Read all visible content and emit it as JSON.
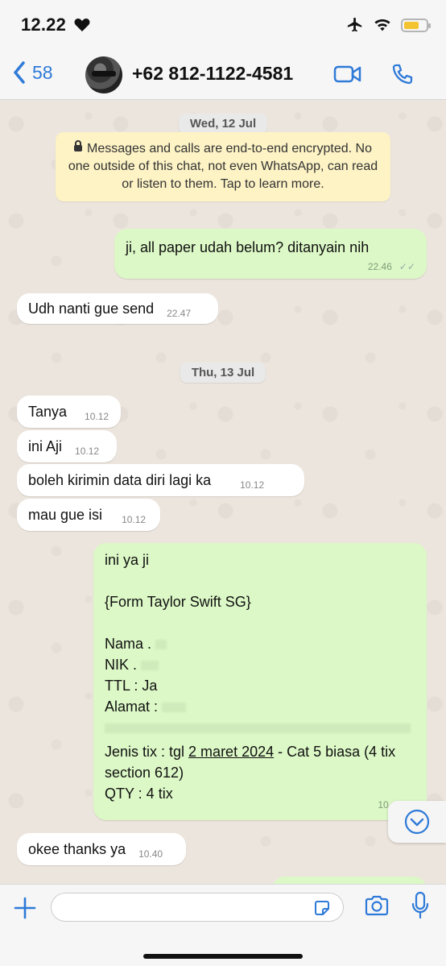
{
  "status_bar": {
    "time": "12.22"
  },
  "header": {
    "back_count": "58",
    "contact": "+62 812-1122-4581"
  },
  "chat": {
    "date1": "Wed, 12 Jul",
    "encryption_notice": "Messages and calls are end-to-end encrypted. No one outside of this chat, not even WhatsApp, can read or listen to them. Tap to learn more.",
    "msg1": {
      "text": "ji, all paper udah belum? ditanyain nih",
      "time": "22.46"
    },
    "msg2": {
      "text": "Udh nanti gue send",
      "time": "22.47"
    },
    "date2": "Thu, 13 Jul",
    "msg3": {
      "text": "Tanya",
      "time": "10.12"
    },
    "msg4": {
      "text": "ini Aji",
      "time": "10.12"
    },
    "msg5": {
      "text": "boleh kirimin data diri lagi ka",
      "time": "10.12"
    },
    "msg6": {
      "text": "mau gue isi",
      "time": "10.12"
    },
    "form": {
      "line1": "ini ya ji",
      "line2": "{Form Taylor Swift SG}",
      "nama": "Nama . ",
      "nik": "NIK . ",
      "ttl": "TTL : Ja",
      "alamat": "Alamat : ",
      "jenis_prefix": "Jenis tix : tgl ",
      "jenis_date": "2 maret 2024",
      "jenis_suffix": " - Cat 5 biasa (4 tix section 612)",
      "qty": "QTY : 4 tix",
      "time": "10."
    },
    "msg7": {
      "text": "okee thanks ya",
      "time": "10.40"
    }
  }
}
